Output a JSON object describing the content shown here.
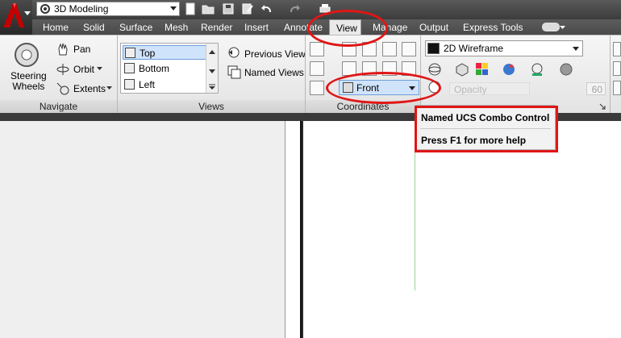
{
  "app": {
    "workspace": "3D Modeling"
  },
  "tabs": [
    "Home",
    "Solid",
    "Surface",
    "Mesh",
    "Render",
    "Insert",
    "Annotate",
    "View",
    "Manage",
    "Output",
    "Express Tools"
  ],
  "active_tab": "View",
  "navigate": {
    "steering_wheels": "Steering\nWheels",
    "pan": "Pan",
    "orbit": "Orbit",
    "extents": "Extents",
    "panel_title": "Navigate"
  },
  "views": {
    "items": [
      "Top",
      "Bottom",
      "Left"
    ],
    "selected": "Top",
    "previous_view": "Previous View",
    "named_views": "Named Views",
    "panel_title": "Views"
  },
  "coordinates": {
    "ucs_combo": "Front",
    "panel_title": "Coordinates"
  },
  "visual_styles": {
    "current": "2D Wireframe",
    "opacity_label": "Opacity",
    "opacity_value": "60"
  },
  "tooltip": {
    "title": "Named UCS Combo Control",
    "help": "Press F1 for more help"
  },
  "colors": {
    "annotation_red": "#e01616",
    "selection_blue": "#cfe3fb",
    "ribbon_bg": "#eeeeee"
  }
}
